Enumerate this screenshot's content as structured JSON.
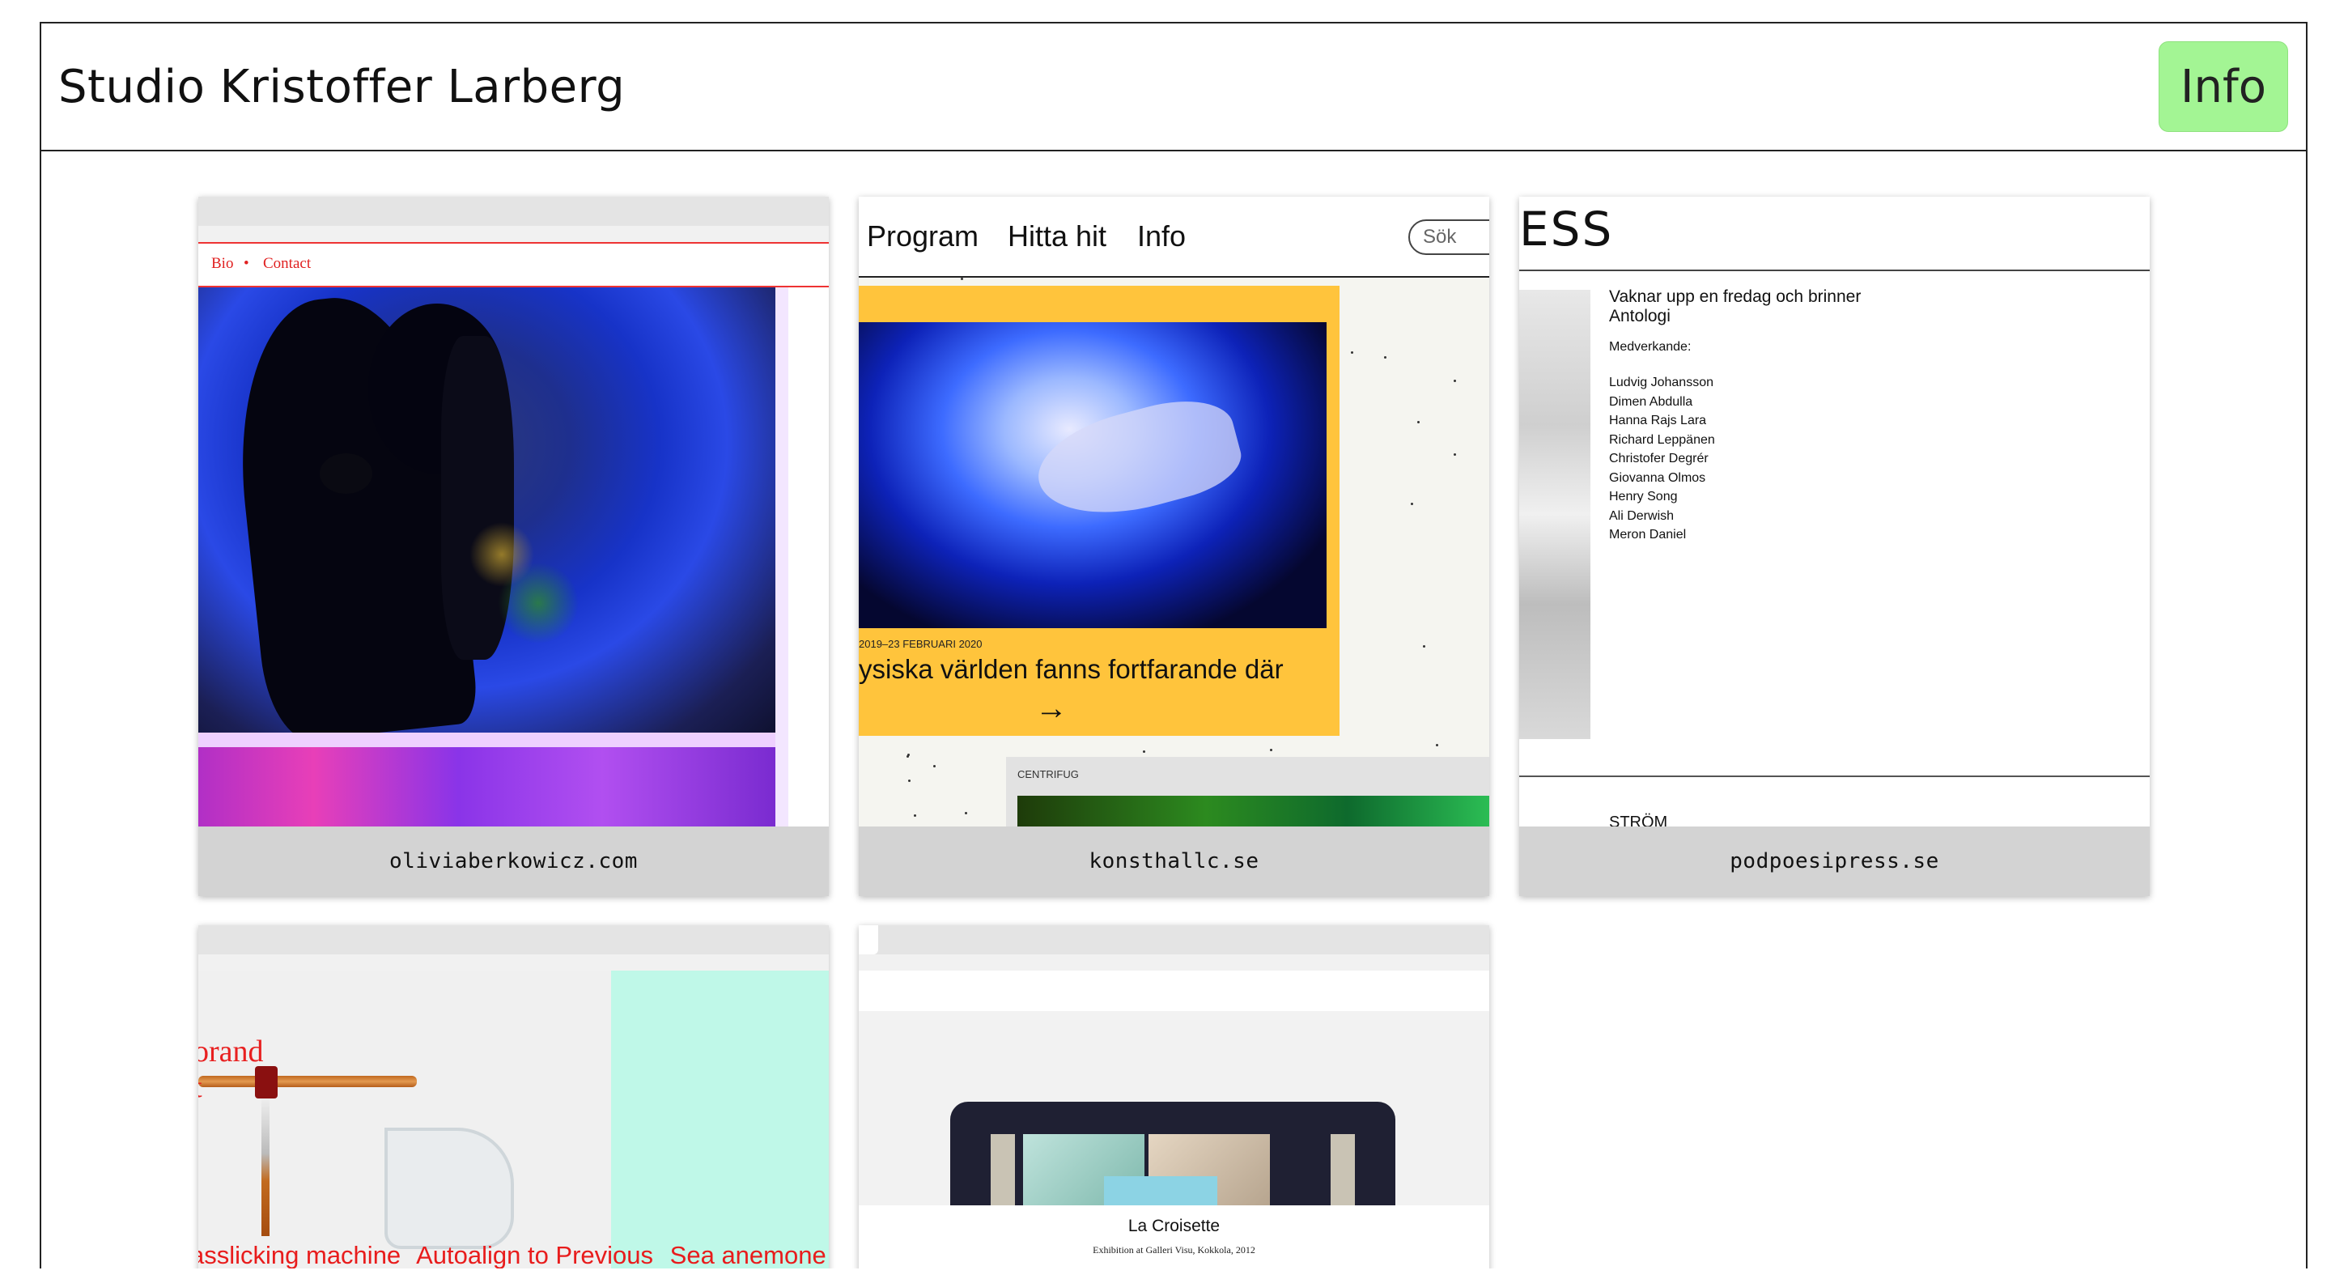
{
  "header": {
    "title": "Studio Kristoffer Larberg",
    "info_label": "Info",
    "info_color": "#a3f594"
  },
  "projects": [
    {
      "caption": "oliviaberkowicz.com",
      "nav": [
        "Bio",
        "•",
        "Contact"
      ]
    },
    {
      "caption": "konsthallc.se",
      "nav": [
        "Program",
        "Hitta hit",
        "Info"
      ],
      "search_placeholder": "Sök",
      "date": "2019–23 FEBRUARI 2020",
      "title": "ysiska världen fanns fortfarande där",
      "arrow": "→",
      "box_label": "CENTRIFUG"
    },
    {
      "caption": "podpoesipress.se",
      "logo": "ESS",
      "heading": "Vaknar upp en fredag och brinner",
      "subheading": "Antologi",
      "contributors_label": "Medverkande:",
      "contributors": [
        "Ludvig Johansson",
        "Dimen Abdulla",
        "Hanna Rajs Lara",
        "Richard Leppänen",
        "Christofer Degrér",
        "Giovanna Olmos",
        "Henry Song",
        "Ali Derwish",
        "Meron Daniel"
      ],
      "footer_word": "STRÖM"
    },
    {
      "caption": "",
      "heading_lines": [
        "orand",
        "t"
      ],
      "links": [
        "asslicking machine",
        "Autoalign to Previous",
        "Sea anemone"
      ]
    },
    {
      "caption": "",
      "title": "La Croisette",
      "subtitle": "Exhibition at Galleri Visu, Kokkola, 2012"
    }
  ]
}
